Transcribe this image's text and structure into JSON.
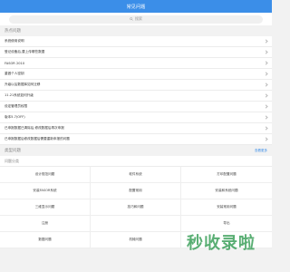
{
  "header": {
    "title": "常见问题"
  },
  "search": {
    "placeholder": "搜索"
  },
  "hot": {
    "title": "热点问题",
    "items": [
      "系统使用说明",
      "登记设备后,要上传哪些数据",
      "FASOR 2010",
      "重做个人密钥",
      "升级以后数据库如何迁移",
      "11.21系统如何升级",
      "设定管理员权限",
      "版本5.7(OFF)",
      "已申报数据已清除后,修改数据后再次申报",
      "已申报数据后修改数据后需要重新申报的问题"
    ]
  },
  "categories_section": {
    "title": "类型问题",
    "more": "查看更多"
  },
  "categories": {
    "subtitle": "问题分类",
    "items": [
      "设计规范问题",
      "软件系统",
      "打印配置问题",
      "安装FASOR系统",
      "配置常用",
      "安装和系统问题",
      "三维显示问题",
      "技巧和问题",
      "安装常用问题",
      "注册",
      "",
      "导出",
      "数据问题",
      "机械问题",
      ""
    ]
  },
  "watermark": {
    "text": "秒收录啦"
  }
}
